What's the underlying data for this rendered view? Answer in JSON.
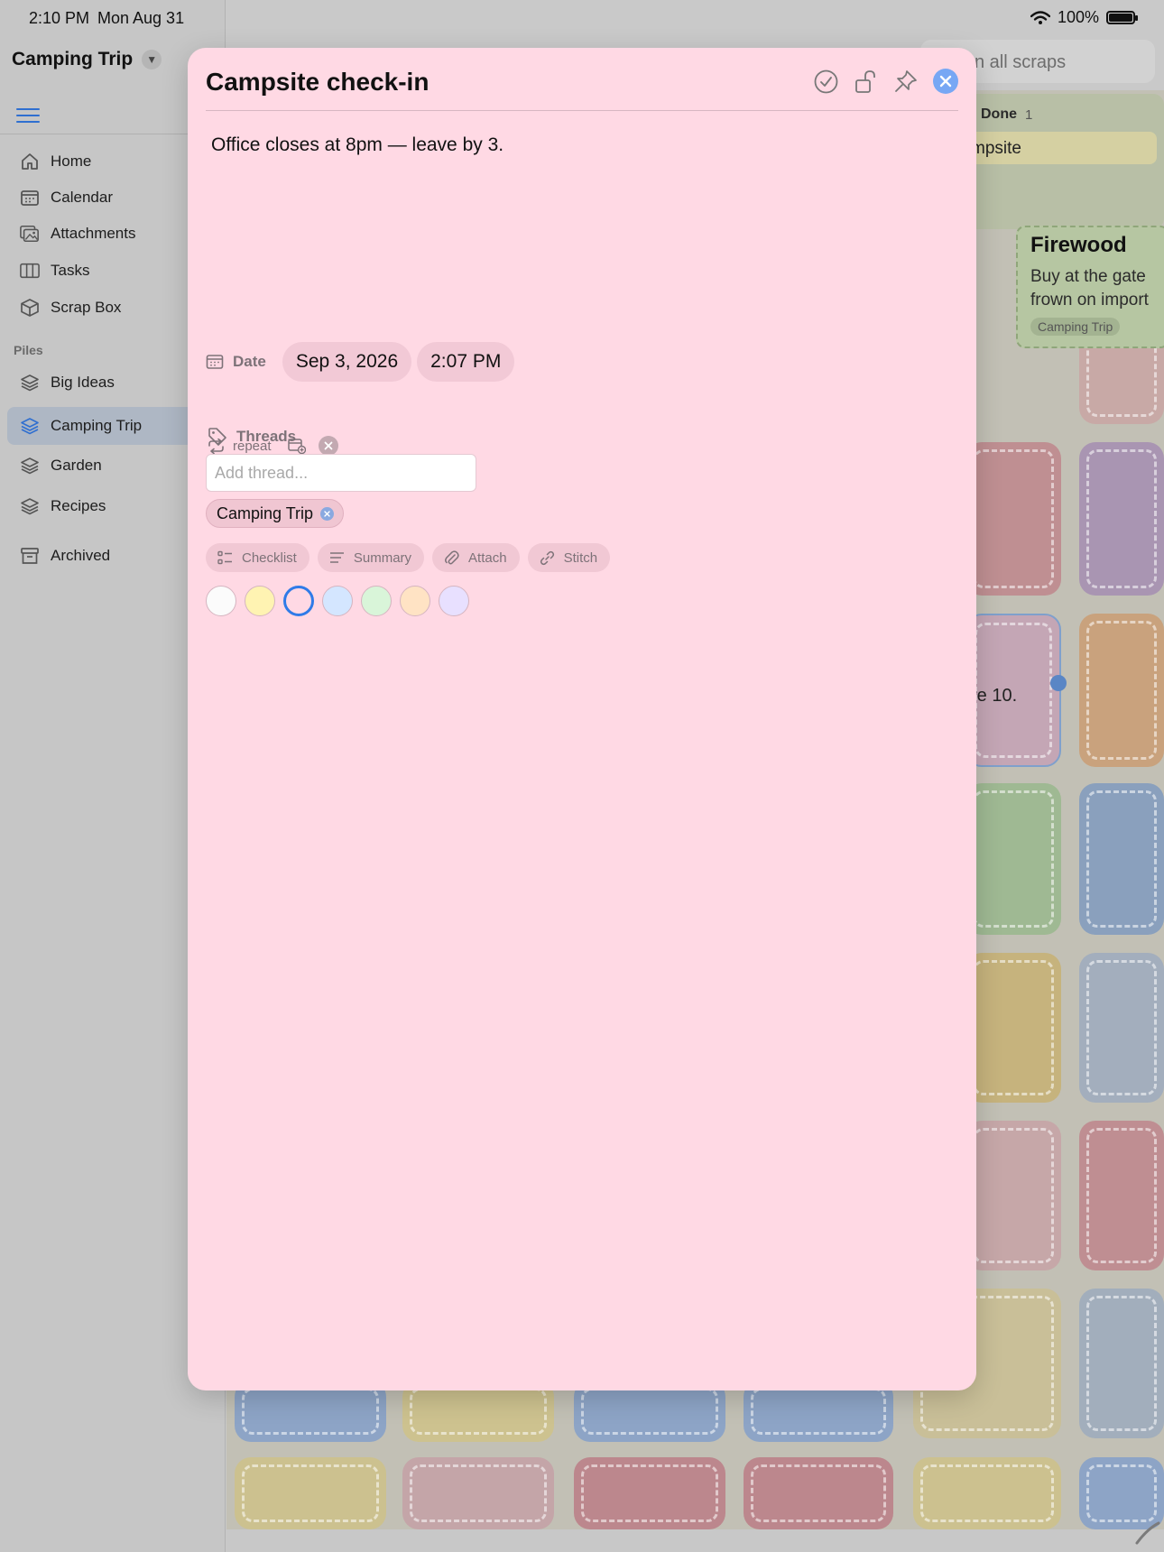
{
  "status_bar": {
    "time": "2:10 PM",
    "date": "Mon Aug 31",
    "battery": "100%"
  },
  "sidebar": {
    "pile_title": "Camping Trip",
    "nav": [
      {
        "label": "Home",
        "icon": "house-icon"
      },
      {
        "label": "Calendar",
        "icon": "calendar-icon"
      },
      {
        "label": "Attachments",
        "icon": "photos-icon"
      },
      {
        "label": "Tasks",
        "icon": "columns-icon"
      },
      {
        "label": "Scrap Box",
        "icon": "box-icon"
      }
    ],
    "piles_header": "Piles",
    "piles": [
      {
        "label": "Big Ideas",
        "active": false
      },
      {
        "label": "Camping Trip",
        "active": true
      },
      {
        "label": "Garden",
        "active": false
      },
      {
        "label": "Recipes",
        "active": false
      }
    ],
    "archived": "Archived"
  },
  "search": {
    "visible_text": "n all scraps"
  },
  "board": {
    "done_label": "Done",
    "done_count": "1",
    "done_card": "mpsite",
    "firewood": {
      "title": "Firewood",
      "line1": "Buy at the gate",
      "line2": "frown on import",
      "tag": "Camping Trip"
    },
    "tile_text": "re 10."
  },
  "modal": {
    "title": "Campsite check-in",
    "body": "Office closes at 8pm — leave by 3.",
    "date_label": "Date",
    "date_value": "Sep 3, 2026",
    "time_value": "2:07 PM",
    "repeat_label": "repeat",
    "threads_label": "Threads",
    "thread_placeholder": "Add thread...",
    "thread_chip": "Camping Trip",
    "tools": [
      "Checklist",
      "Summary",
      "Attach",
      "Stitch"
    ],
    "swatches": [
      {
        "color": "#fbfbfb",
        "selected": false
      },
      {
        "color": "#fff3b2",
        "selected": false
      },
      {
        "color": "#ffd9e4",
        "selected": true
      },
      {
        "color": "#d4e6ff",
        "selected": false
      },
      {
        "color": "#d9f5d9",
        "selected": false
      },
      {
        "color": "#ffe3c4",
        "selected": false
      },
      {
        "color": "#e8e0ff",
        "selected": false
      }
    ]
  }
}
